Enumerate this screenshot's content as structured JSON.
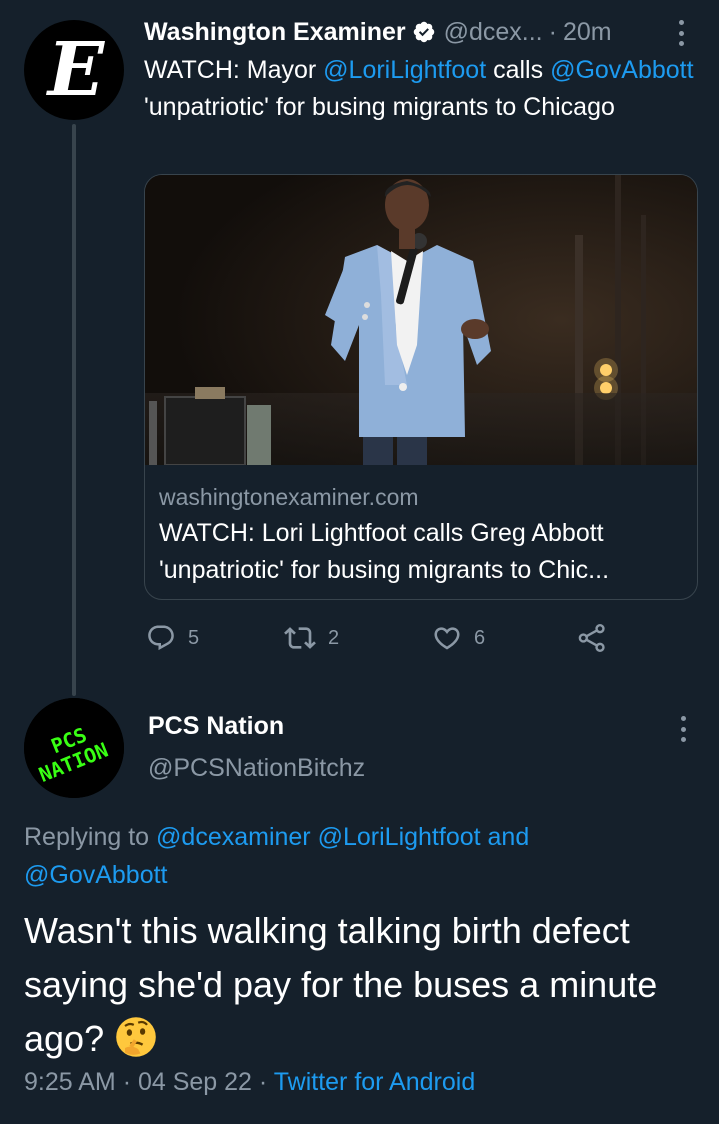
{
  "parent_tweet": {
    "avatar_letter": "E",
    "author_name": "Washington Examiner",
    "handle": "@dcex...",
    "separator": "·",
    "time": "20m",
    "text_prefix": "WATCH: Mayor ",
    "mention1": "@LoriLightfoot",
    "text_mid": " calls ",
    "mention2": "@GovAbbott",
    "text_suffix": " 'unpatriotic' for busing migrants to Chicago",
    "card": {
      "domain": "washingtonexaminer.com",
      "title_line1": "WATCH: Lori Lightfoot calls Greg Abbott",
      "title_line2": "'unpatriotic' for busing migrants to Chic..."
    },
    "actions": {
      "reply_count": "5",
      "retweet_count": "2",
      "like_count": "6"
    }
  },
  "reply_tweet": {
    "avatar_text_line1": "PCS",
    "avatar_text_line2": "NATION",
    "author_name": "PCS Nation",
    "handle": "@PCSNationBitchz",
    "replying_prefix": "Replying to ",
    "replying_m1": "@dcexaminer",
    "replying_m2": "@LoriLightfoot",
    "replying_and": " and",
    "replying_m3": "@GovAbbott",
    "text": "Wasn't this walking talking birth defect saying she'd pay for the buses a minute ago?",
    "emoji_name": "thinking-face-emoji",
    "time": "9:25 AM",
    "sep1": "·",
    "date": "04 Sep 22",
    "sep2": "·",
    "source": "Twitter for Android"
  },
  "colors": {
    "background": "#15202b",
    "accent": "#1d9bf0",
    "secondary_text": "#8b98a5",
    "border": "#38444d",
    "pcs_green": "#39ff14"
  }
}
